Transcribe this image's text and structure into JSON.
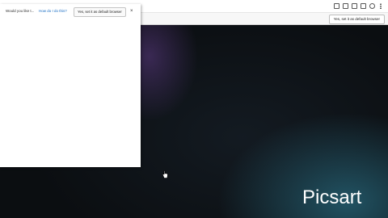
{
  "infobar": {
    "set_default_label": "Yes, set it as default browser"
  },
  "popup": {
    "question": "Would you like t...",
    "link": "How do I do this?",
    "yes_label": "Yes, set it as default browser",
    "close_glyph": "×"
  },
  "watermark": {
    "text": "Picsart"
  },
  "icons": {
    "toolbar": [
      "screenshot-icon",
      "extensions-icon",
      "favorites-icon",
      "collections-icon",
      "profile-icon",
      "more-icon"
    ],
    "cursor": "hand-pointer-icon"
  }
}
